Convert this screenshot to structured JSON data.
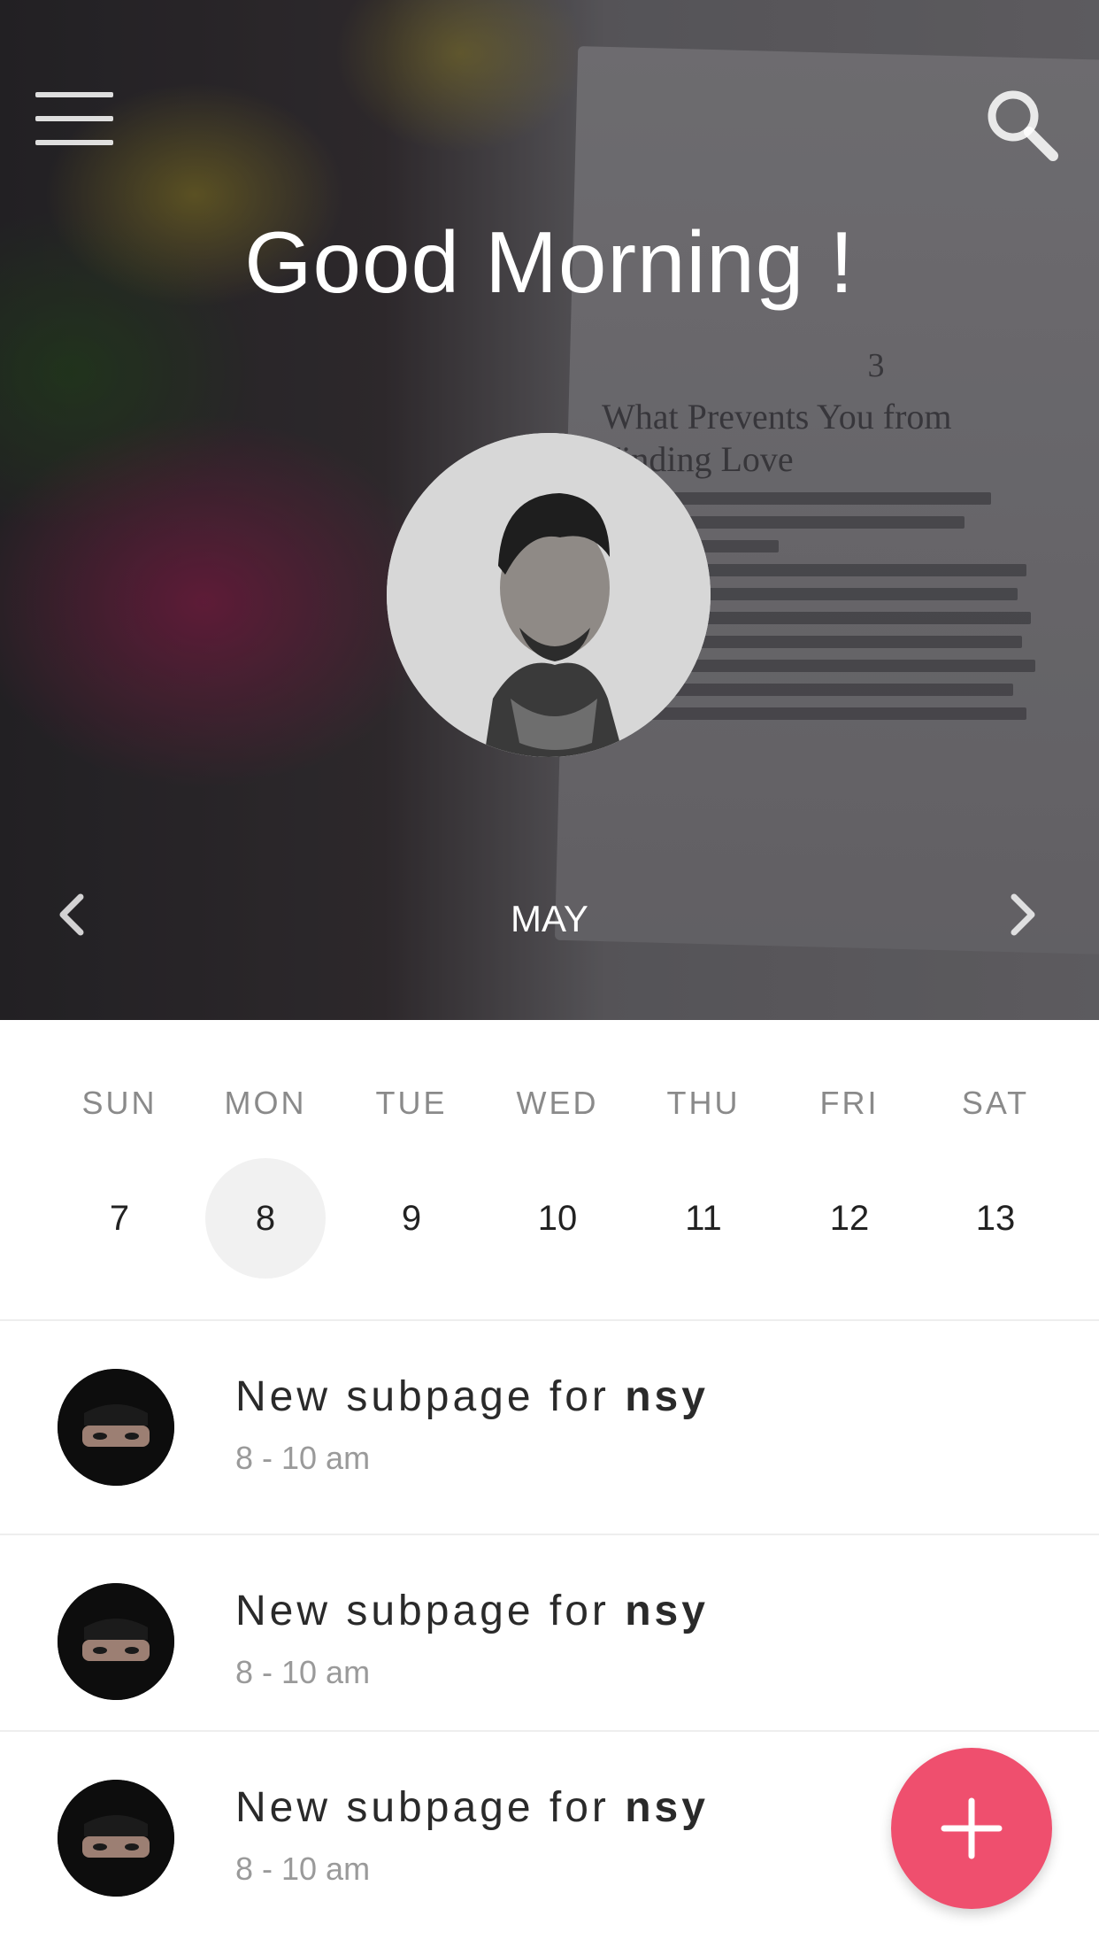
{
  "header": {
    "greeting": "Good Morning !",
    "month": "MAY"
  },
  "book_background": {
    "chapter_number": "3",
    "chapter_title": "What Prevents You from Finding Love"
  },
  "week": {
    "days": [
      "SUN",
      "MON",
      "TUE",
      "WED",
      "THU",
      "FRI",
      "SAT"
    ],
    "dates": [
      "7",
      "8",
      "9",
      "10",
      "11",
      "12",
      "13"
    ],
    "selected_index": 1
  },
  "events": [
    {
      "title_prefix": "New subpage for ",
      "title_bold": "nsy",
      "time": "8 - 10 am"
    },
    {
      "title_prefix": "New subpage for ",
      "title_bold": "nsy",
      "time": "8 - 10 am"
    },
    {
      "title_prefix": "New subpage for ",
      "title_bold": "nsy",
      "time": "8 - 10 am"
    }
  ],
  "colors": {
    "accent": "#ef4f6e",
    "selected_date_bg": "#f1f1f1"
  },
  "icons": {
    "menu": "menu-icon",
    "search": "search-icon",
    "prev": "chevron-left-icon",
    "next": "chevron-right-icon",
    "add": "plus-icon"
  }
}
